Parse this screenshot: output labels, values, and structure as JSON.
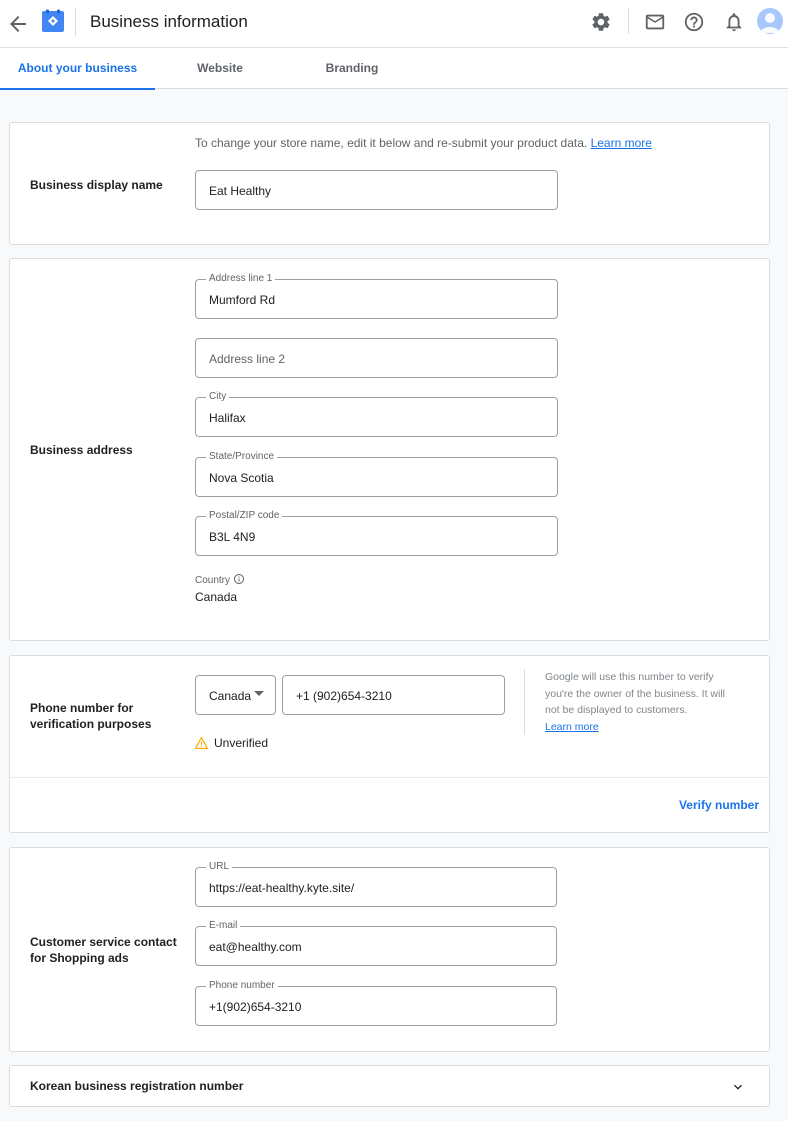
{
  "header": {
    "title": "Business information",
    "icons": [
      "back-arrow-icon",
      "merchant-logo-icon",
      "settings-icon",
      "mail-icon",
      "help-icon",
      "notifications-icon",
      "avatar-icon"
    ]
  },
  "tabs": [
    {
      "label": "About your business",
      "active": true
    },
    {
      "label": "Website",
      "active": false
    },
    {
      "label": "Branding",
      "active": false
    }
  ],
  "display_name": {
    "label": "Business display name",
    "hint": "To change your store name, edit it below and re-submit your product data.",
    "hint_link": "Learn more",
    "value": "Eat Healthy"
  },
  "address": {
    "label": "Business address",
    "line1_label": "Address line 1",
    "line1_value": "Mumford Rd",
    "line2_placeholder": "Address line 2",
    "city_label": "City",
    "city_value": "Halifax",
    "state_label": "State/Province",
    "state_value": "Nova Scotia",
    "postal_label": "Postal/ZIP code",
    "postal_value": "B3L 4N9",
    "country_label": "Country",
    "country_value": "Canada"
  },
  "phone": {
    "label_line1": "Phone number for",
    "label_line2": "verification purposes",
    "country": "Canada",
    "number": "+1 (902)654-3210",
    "status": "Unverified",
    "info_line1": "Google will use this number to verify",
    "info_line2": "you're the owner of the business. It will",
    "info_line3": "not be displayed to customers.",
    "info_link": "Learn more",
    "verify_label": "Verify number"
  },
  "customer_service": {
    "label_line1": "Customer service contact",
    "label_line2": "for Shopping ads",
    "url_label": "URL",
    "url_value": "https://eat-healthy.kyte.site/",
    "email_label": "E-mail",
    "email_value": "eat@healthy.com",
    "phone_label": "Phone number",
    "phone_value": "+1(902)654-3210"
  },
  "korean": {
    "label": "Korean business registration number"
  },
  "colors": {
    "accent": "#1a73e8",
    "warning": "#f9ab00",
    "text": "#202124",
    "muted": "#5f6368"
  }
}
